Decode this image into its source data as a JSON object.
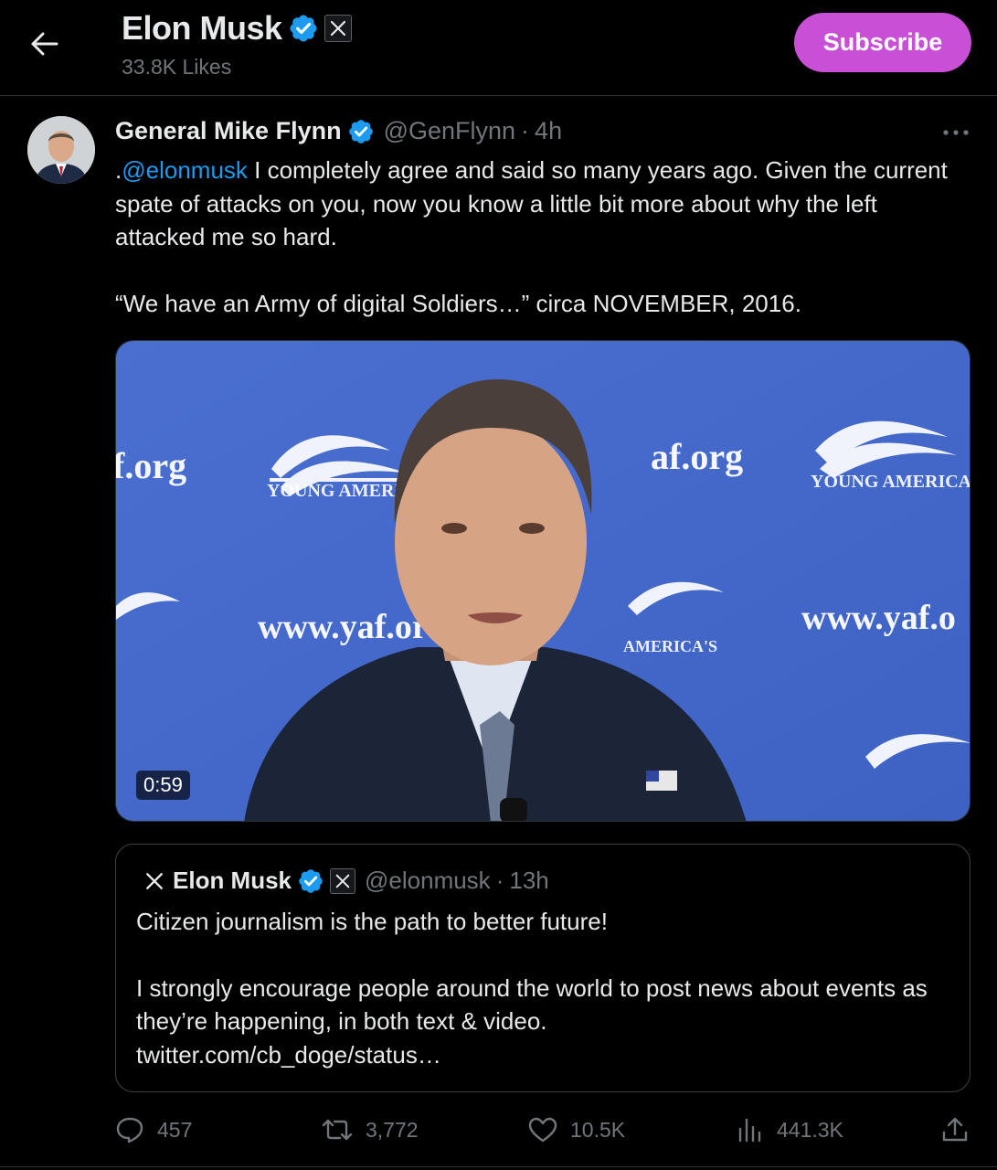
{
  "header": {
    "name": "Elon Musk",
    "likes": "33.8K Likes",
    "subscribe_label": "Subscribe",
    "back_icon": "arrow-left-icon",
    "verified_icon": "verified-badge-icon",
    "affiliate_icon": "x-logo-icon"
  },
  "post": {
    "author": "General Mike Flynn",
    "handle": "@GenFlynn",
    "separator": "·",
    "time": "4h",
    "mention": "@elonmusk",
    "text_prefix": ".",
    "text_line1": " I completely agree and said so many years ago. Given the current spate of attacks on you, now you know a little bit more about why the left attacked me so hard.",
    "text_line2": "“We have an Army of digital Soldiers…” circa NOVEMBER, 2016.",
    "video_duration": "0:59",
    "more_icon": "more-horizontal-icon"
  },
  "quote": {
    "author": "Elon Musk",
    "handle": "@elonmusk",
    "separator": "·",
    "time": "13h",
    "line1": "Citizen journalism is the path to better future!",
    "line2": "I strongly encourage people around the world to post news about events as they’re happening, in both text & video.",
    "link": "twitter.com/cb_doge/status…"
  },
  "actions": {
    "replies": "457",
    "reposts": "3,772",
    "likes": "10.5K",
    "views": "441.3K"
  },
  "colors": {
    "background": "#000000",
    "text": "#e7e9ea",
    "muted": "#71767b",
    "link": "#1d9bf0",
    "verified": "#1d9bf0",
    "subscribe": "#c94fd6",
    "border": "#2f3336"
  }
}
